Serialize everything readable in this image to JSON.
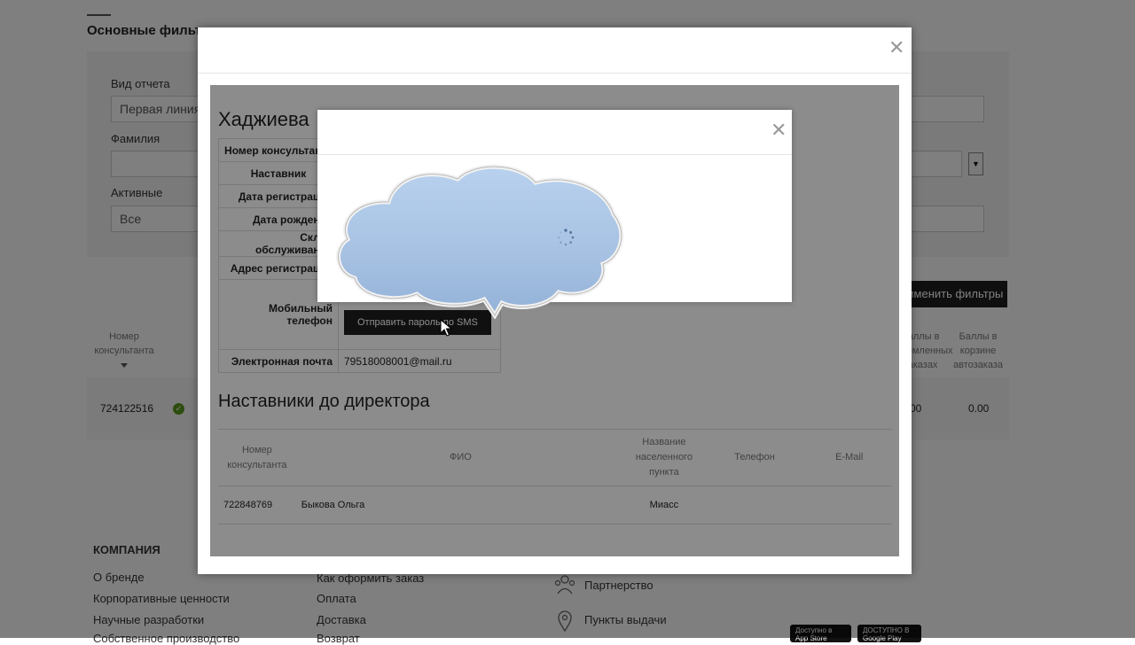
{
  "background": {
    "filters_title": "Основные фильтры",
    "report_type_label": "Вид отчета",
    "report_type_value": "Первая линия",
    "surname_label": "Фамилия",
    "surname_value": "",
    "active_label": "Активные",
    "active_value": "Все",
    "apply_label": "Применить фильтры",
    "table_headers": {
      "consultant_no": "Номер консультанта",
      "points_orders": "Баллы в оформленных заказах",
      "points_autoorder": "Баллы в корзине автозаказа"
    },
    "row": {
      "consultant_no": "724122516",
      "points_orders": "0.00",
      "points_autoorder": "0.00"
    }
  },
  "footer": {
    "company_heading": "КОМПАНИЯ",
    "col1": [
      "О бренде",
      "Корпоративные ценности",
      "Научные разработки",
      "Собственное производство"
    ],
    "col2": [
      "Как оформить заказ",
      "Оплата",
      "Доставка",
      "Возврат"
    ],
    "col3": [
      {
        "label": "Партнерство",
        "icon": "people-icon"
      },
      {
        "label": "Пункты выдачи",
        "icon": "map-pin-icon"
      }
    ],
    "badges": [
      "Доступно в App Store",
      "ДОСТУПНО В Google Play"
    ]
  },
  "consultant_modal": {
    "name": "Хаджиева",
    "fields": [
      {
        "label": "Номер консультанта",
        "value": ""
      },
      {
        "label": "Наставник",
        "value": ""
      },
      {
        "label": "Дата регистрации",
        "value": ""
      },
      {
        "label": "Дата рождения",
        "value": ""
      },
      {
        "label": "Склад обслуживания",
        "value": ""
      },
      {
        "label": "Адрес регистрации",
        "value": ""
      }
    ],
    "mobile_label": "Мобильный телефон",
    "sms_button": "Отправить пароль по SMS",
    "email_label": "Электронная почта",
    "email_value": "79518008001@mail.ru",
    "mentors_heading": "Наставники до директора",
    "mentors_headers": [
      "Номер консультанта",
      "ФИО",
      "Название населенного пункта",
      "Телефон",
      "E-Mail"
    ],
    "mentors_rows": [
      {
        "number": "722848769",
        "name": "Быкова Ольга",
        "city": "Миасс",
        "phone": "",
        "email": ""
      }
    ]
  },
  "loading_modal": {
    "status": "loading"
  },
  "colors": {
    "dark_button": "#1e1e1e",
    "cloud": "#a9c4e3",
    "success": "#5a9a1e"
  }
}
